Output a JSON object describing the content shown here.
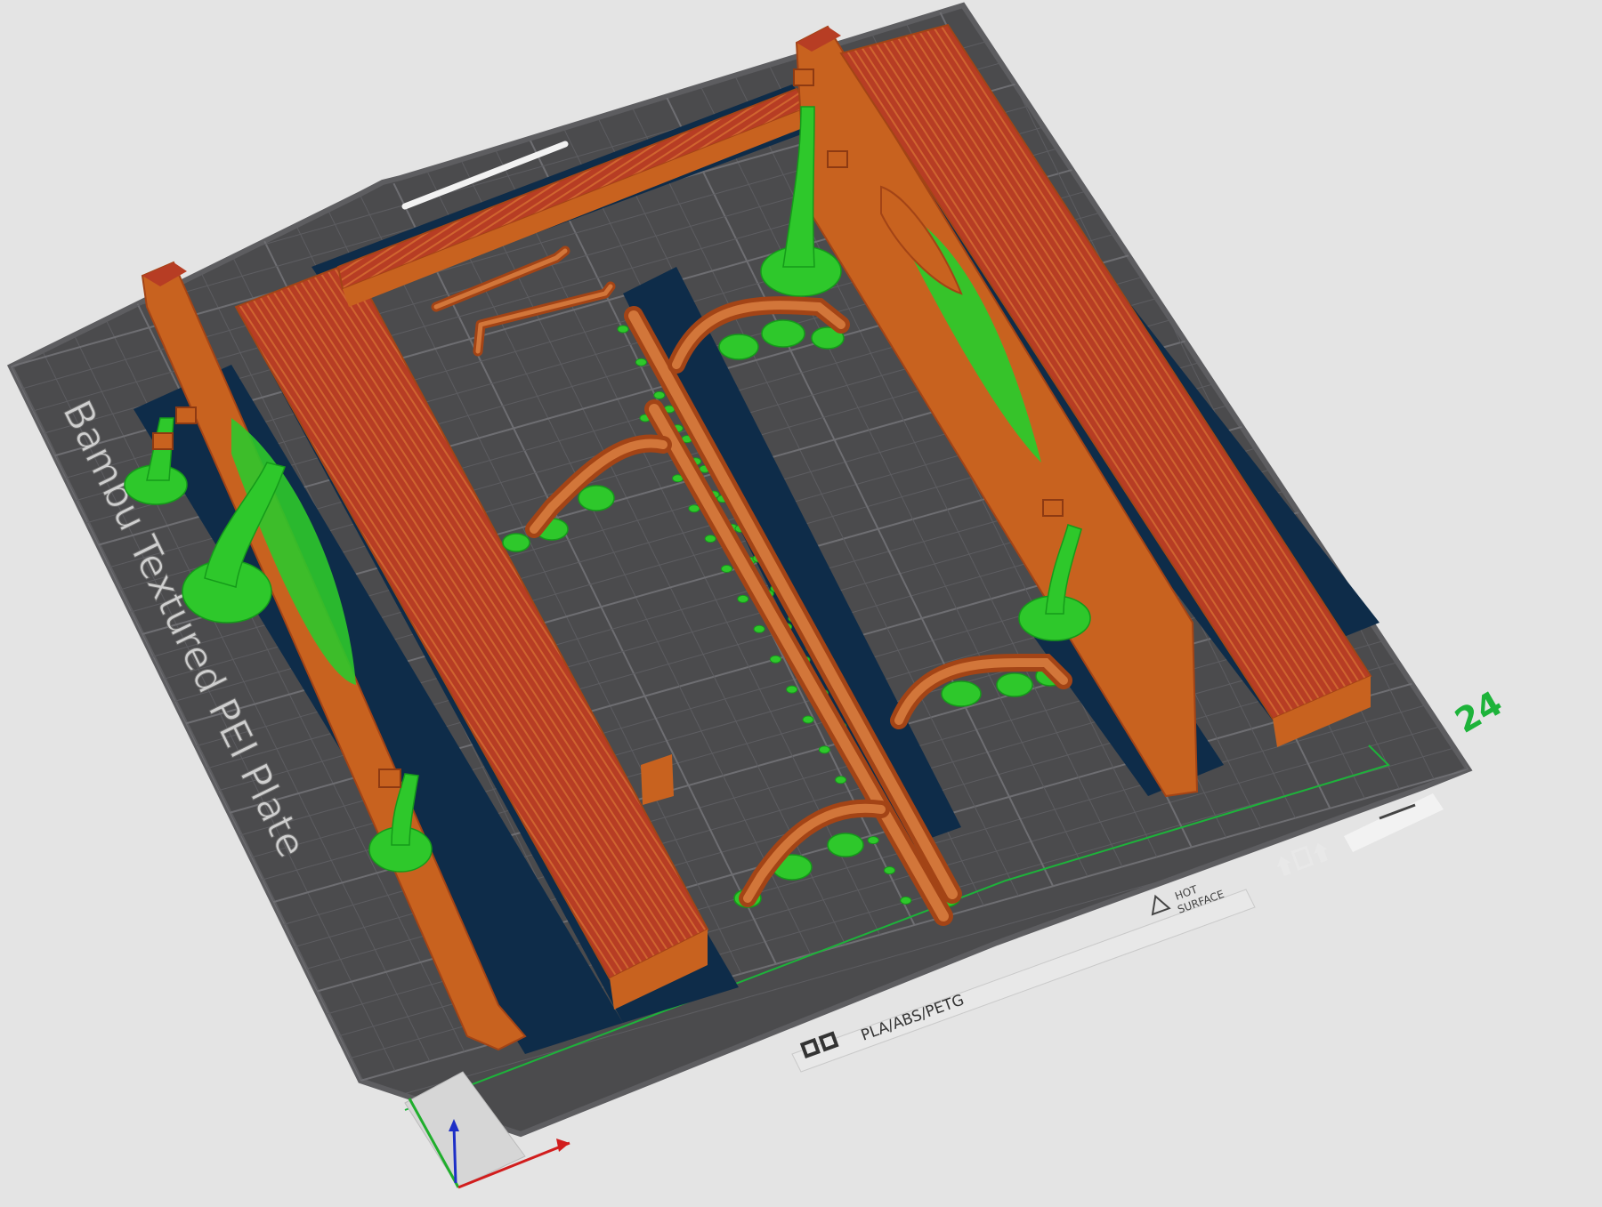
{
  "plate": {
    "name": "Bambu Textured PEI Plate",
    "materials": "PLA/ABS/PETG",
    "warning_line1": "HOT",
    "warning_line2": "SURFACE",
    "plate_number": "24"
  },
  "colors": {
    "background": "#e4e4e4",
    "plate": "#4b4b4d",
    "plate_border": "#5b5b5e",
    "grid": "#636366",
    "model_orange": "#c8621f",
    "model_orange_dark": "#a34416",
    "model_top_red": "#b73d24",
    "support_green": "#2ec82b",
    "brim_navy": "#0e2c49",
    "plate_number_green": "#1db33a",
    "axis_x": "#d11d1d",
    "axis_y": "#1fae2c",
    "axis_z": "#1d2fc7"
  },
  "icons": {
    "view_cube": "view-cube-icon",
    "axes": "axes-gizmo-icon",
    "warning": "warning-triangle-icon",
    "bambu_logo": "bambu-logo-icon"
  }
}
